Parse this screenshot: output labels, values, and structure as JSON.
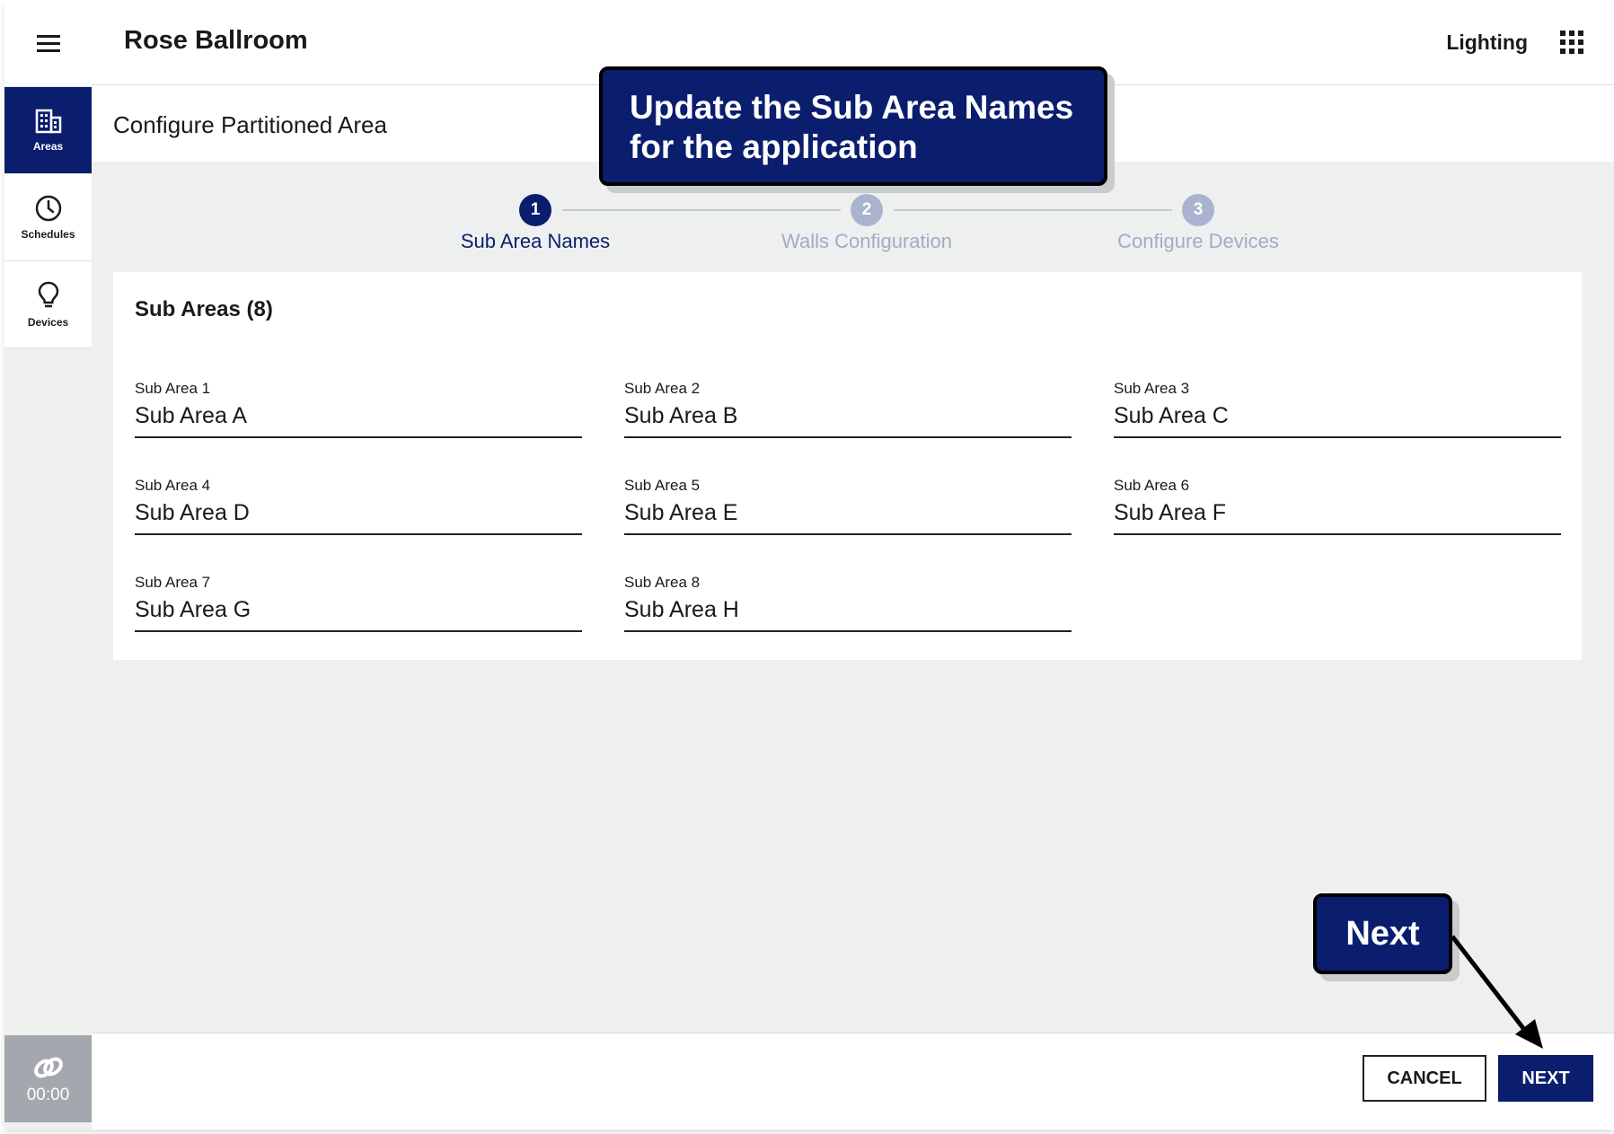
{
  "header": {
    "area_title": "Rose Ballroom",
    "app_name": "Lighting"
  },
  "sidebar": {
    "items": [
      {
        "label": "Areas",
        "icon": "building-icon",
        "active": true
      },
      {
        "label": "Schedules",
        "icon": "clock-icon",
        "active": false
      },
      {
        "label": "Devices",
        "icon": "lightbulb-icon",
        "active": false
      }
    ],
    "timer": "00:00"
  },
  "page": {
    "title": "Configure Partitioned Area"
  },
  "stepper": {
    "steps": [
      {
        "number": "1",
        "label": "Sub Area Names",
        "active": true
      },
      {
        "number": "2",
        "label": "Walls Configuration",
        "active": false
      },
      {
        "number": "3",
        "label": "Configure Devices",
        "active": false
      }
    ]
  },
  "sub_areas": {
    "title": "Sub Areas (8)",
    "fields": [
      {
        "label": "Sub Area 1",
        "value": "Sub Area A"
      },
      {
        "label": "Sub Area 2",
        "value": "Sub Area B"
      },
      {
        "label": "Sub Area 3",
        "value": "Sub Area C"
      },
      {
        "label": "Sub Area 4",
        "value": "Sub Area D"
      },
      {
        "label": "Sub Area 5",
        "value": "Sub Area E"
      },
      {
        "label": "Sub Area 6",
        "value": "Sub Area F"
      },
      {
        "label": "Sub Area 7",
        "value": "Sub Area G"
      },
      {
        "label": "Sub Area 8",
        "value": "Sub Area H"
      }
    ]
  },
  "footer": {
    "cancel_label": "CANCEL",
    "next_label": "NEXT"
  },
  "callouts": {
    "instruction_prefix": "Update the ",
    "instruction_emphasis": "Sub Area Names",
    "instruction_suffix": "for the application",
    "next_hint": "Next"
  },
  "colors": {
    "primary": "#0b1e6e",
    "background": "#eef0ef",
    "inactive_step": "#a9b3cf",
    "timer_bg": "#a4a7ad"
  }
}
